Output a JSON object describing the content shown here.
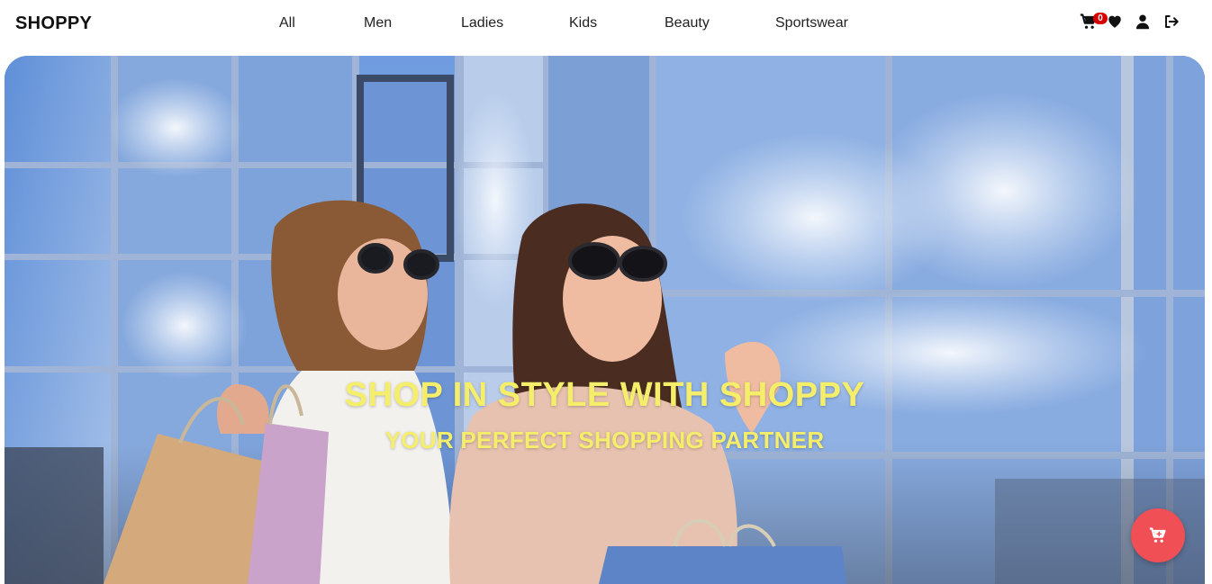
{
  "header": {
    "brand": "SHOPPY",
    "nav": [
      "All",
      "Men",
      "Ladies",
      "Kids",
      "Beauty",
      "Sportswear"
    ],
    "cart_count": "0",
    "icons": [
      "cart-icon",
      "heart-icon",
      "user-icon",
      "logout-icon"
    ]
  },
  "hero": {
    "title": "SHOP IN STYLE WITH SHOPPY",
    "subtitle": "YOUR PERFECT SHOPPING PARTNER"
  },
  "floating_action": {
    "icon": "cart-plus-icon",
    "color": "#ef4f55"
  },
  "colors": {
    "hero_text": "#f5ee6a",
    "badge": "#d50000",
    "brand_text": "#111111"
  }
}
